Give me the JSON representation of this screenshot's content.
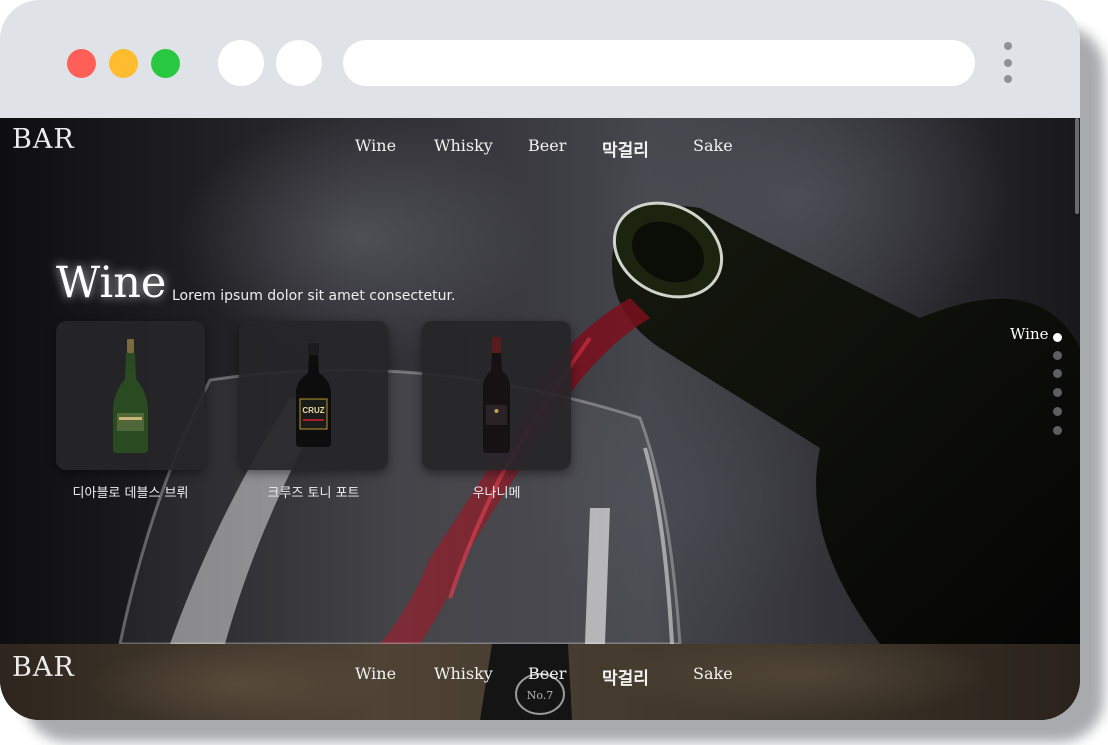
{
  "browser": {
    "address_value": "",
    "kebab_icon": "kebab-menu-icon"
  },
  "site": {
    "logo": "BAR",
    "nav": [
      "Wine",
      "Whisky",
      "Beer",
      "막걸리",
      "Sake"
    ]
  },
  "section": {
    "title": "Wine",
    "subtitle": "Lorem ipsum dolor sit amet consectetur.",
    "products": [
      {
        "name": "디아블로 데블스 브뤼",
        "icon": "sparkling-wine-bottle-icon"
      },
      {
        "name": "크루즈 토니 포트",
        "icon": "port-wine-bottle-icon"
      },
      {
        "name": "우나니메",
        "icon": "red-wine-bottle-icon"
      }
    ]
  },
  "side_nav": {
    "active_label": "Wine",
    "dot_count": 6,
    "active_index": 0
  },
  "next_section": {
    "logo": "BAR",
    "nav": [
      "Wine",
      "Whisky",
      "Beer",
      "막걸리",
      "Sake"
    ]
  },
  "colors": {
    "traffic_red": "#ff5f57",
    "traffic_yellow": "#febc2e",
    "traffic_green": "#28c840",
    "chrome_bg": "#dfe2e6",
    "wine_red": "#8c1020"
  }
}
